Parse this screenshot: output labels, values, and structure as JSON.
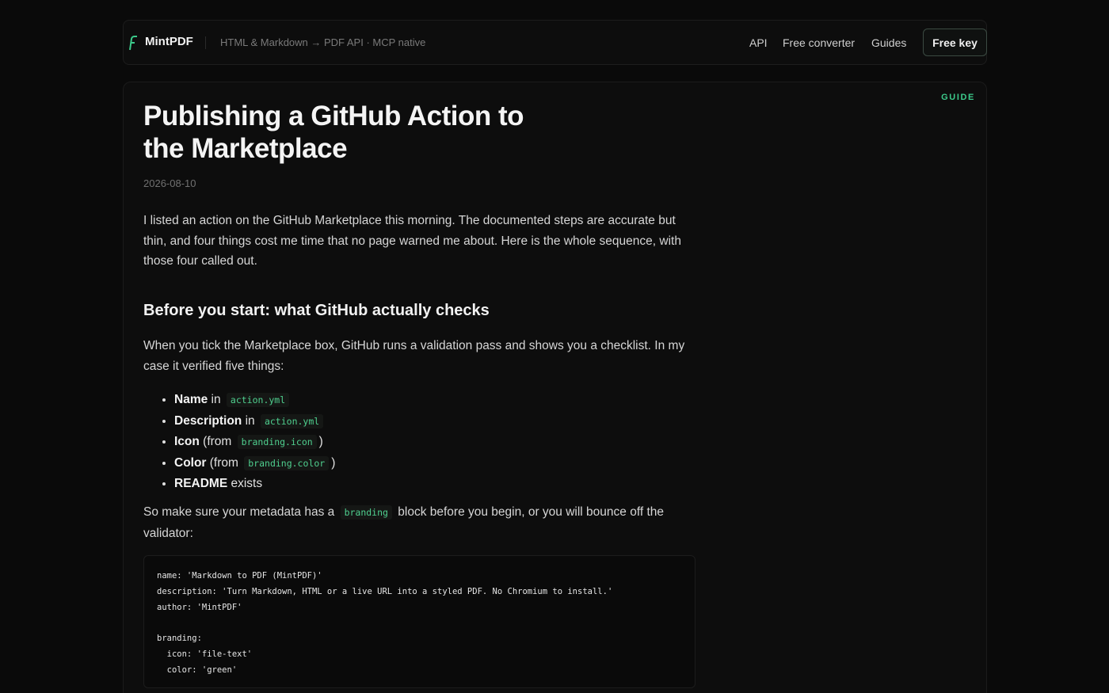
{
  "header": {
    "brand": "MintPDF",
    "tagline": "HTML & Markdown → PDF API · MCP native",
    "nav": [
      "API",
      "Free converter",
      "Guides"
    ],
    "cta": "Free key"
  },
  "article": {
    "badge": "GUIDE",
    "title": "Publishing a GitHub Action to the Marketplace",
    "date": "2026-08-10",
    "intro": "I listed an action on the GitHub Marketplace this morning. The documented steps are accurate but thin, and four things cost me time that no page warned me about. Here is the whole sequence, with those four called out.",
    "section_heading": "Before you start: what GitHub actually checks",
    "section_text": "When you tick the Marketplace box, GitHub runs a validation pass and shows you a checklist. In my case it verified five things:",
    "checklist": [
      {
        "bold": "Name",
        "pre": " in ",
        "code": "action.yml",
        "post": ""
      },
      {
        "bold": "Description",
        "pre": " in ",
        "code": "action.yml",
        "post": ""
      },
      {
        "bold": "Icon",
        "pre": " (from ",
        "code": "branding.icon",
        "post": ")"
      },
      {
        "bold": "Color",
        "pre": " (from ",
        "code": "branding.color",
        "post": ")"
      },
      {
        "bold": "README",
        "pre": " exists",
        "code": "",
        "post": ""
      }
    ],
    "branding_pre": "So make sure your metadata has a ",
    "branding_code": "branding",
    "branding_post": " block before you begin, or you will bounce off the validator:",
    "code_lines": [
      "name: 'Markdown to PDF (MintPDF)'",
      "description: 'Turn Markdown, HTML or a live URL into a styled PDF. No Chromium to install.'",
      "author: 'MintPDF'",
      "",
      "branding:",
      "  icon: 'file-text'",
      "  color: 'green'"
    ]
  },
  "colors": {
    "accent": "#3cc98a",
    "background": "#0a0a0a",
    "card": "#0d0d0d"
  }
}
